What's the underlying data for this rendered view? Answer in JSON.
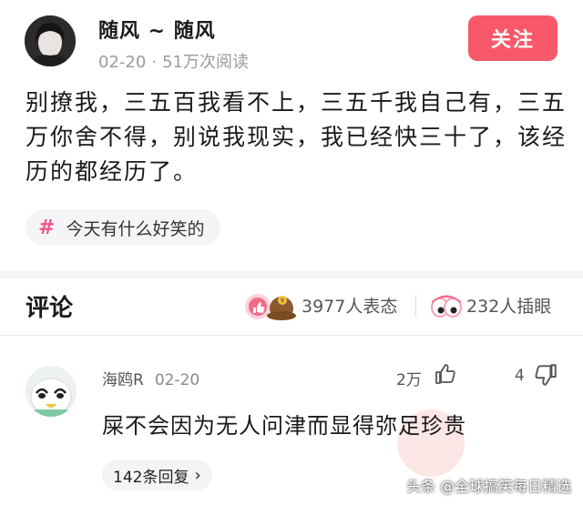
{
  "post": {
    "author": "随风 ~ 随风",
    "date": "02-20",
    "reads": "51万次阅读",
    "follow_label": "关注",
    "content": "别撩我，三五百我看不上，三五千我自己有，三五万你舍不得，别说我现实，我已经快三十了，该经历的都经历了。",
    "topic": "今天有什么好笑的"
  },
  "comments_section": {
    "title": "评论",
    "reactions_label": "3977人表态",
    "gawkers_label": "232人插眼"
  },
  "comment": {
    "user": "海鸥R",
    "date": "02-20",
    "likes": "2万",
    "dislikes": "4",
    "text": "屎不会因为无人问津而显得弥足珍贵",
    "replies_label": "142条回复"
  },
  "watermark": "头条 @全球搞笑每日精选",
  "colors": {
    "accent": "#f8596a",
    "topic_hash": "#f0588a",
    "text_primary": "#1a1a1a",
    "text_secondary": "#9b9b9b"
  }
}
